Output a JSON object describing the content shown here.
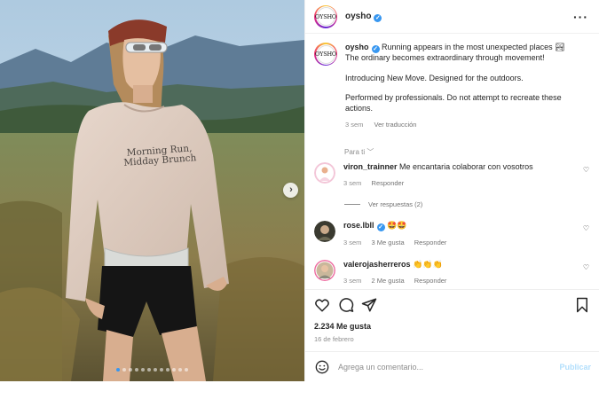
{
  "post": {
    "username": "oysho",
    "brand_mark": "OYSHO",
    "caption_lines": [
      "Running appears in the most unexpected places 🏞",
      "The ordinary becomes extraordinary through movement!"
    ],
    "caption_p2": "Introducing New Move. Designed for the outdoors.",
    "caption_p3": "Performed by professionals. Do not attempt to recreate these actions.",
    "caption_time": "3 sem",
    "see_translation": "Ver traducción",
    "shirt_print": [
      "Morning Run,",
      "Midday Brunch"
    ]
  },
  "sort_label": "Para ti",
  "comments": [
    {
      "user": "viron_trainner",
      "text": "Me encantaria colaborar con vosotros",
      "time": "3 sem",
      "likes": "",
      "reply": "Responder",
      "verified": false
    },
    {
      "user": "rose.lbll",
      "text": "🤩🤩",
      "time": "3 sem",
      "likes": "3 Me gusta",
      "reply": "Responder",
      "verified": true
    },
    {
      "user": "valerojasherreros",
      "text": "👏👏👏",
      "time": "3 sem",
      "likes": "2 Me gusta",
      "reply": "Responder",
      "verified": false
    }
  ],
  "view_replies": "Ver respuestas (2)",
  "actions": {
    "like_count": "2.234 Me gusta",
    "date": "16 de febrero"
  },
  "composer": {
    "placeholder": "Agrega un comentario...",
    "publish_label": "Publicar"
  },
  "carousel": {
    "total": 12,
    "active": 0
  },
  "colors": {
    "accent": "#3897f0",
    "publish_disabled": "#b2dffc",
    "muted_text": "#8e8e8e"
  }
}
